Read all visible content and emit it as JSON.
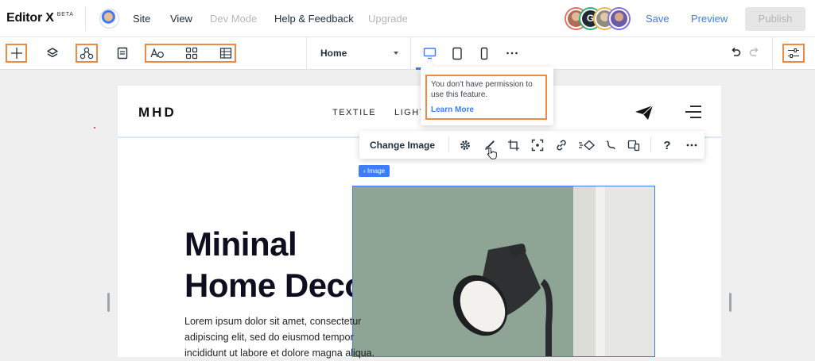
{
  "app": {
    "name": "Editor X",
    "badge": "BETA"
  },
  "topbar": {
    "menu": [
      {
        "label": "Site",
        "enabled": true
      },
      {
        "label": "View",
        "enabled": true
      },
      {
        "label": "Dev Mode",
        "enabled": false
      },
      {
        "label": "Help & Feedback",
        "enabled": true
      },
      {
        "label": "Upgrade",
        "enabled": false
      }
    ],
    "collaborator_initial": "G",
    "save_label": "Save",
    "preview_label": "Preview",
    "publish_label": "Publish"
  },
  "toolbar": {
    "page_selector_value": "Home",
    "active_breakpoint": "desktop",
    "icons": [
      "add-icon",
      "layers-icon",
      "site-structure-icon",
      "pages-icon",
      "typography-icon",
      "grid-icon",
      "table-icon",
      "desktop-icon",
      "tablet-icon",
      "mobile-icon",
      "more-icon",
      "undo-icon",
      "redo-icon",
      "settings-sliders-icon"
    ]
  },
  "tooltip": {
    "message": "You don't have permission to use this feature.",
    "link": "Learn More"
  },
  "site": {
    "brand": "MHD",
    "nav": [
      "TEXTILE",
      "LIGHT"
    ],
    "hero_title_line1": "Mininal",
    "hero_title_line2": "Home Decor",
    "hero_text_line1": "Lorem ipsum dolor sit amet, consectetur",
    "hero_text_line2": "adipiscing elit, sed do eiusmod tempor",
    "hero_text_line3": "incididunt ut labore et dolore magna aliqua."
  },
  "image_toolbar": {
    "change_image_label": "Change Image",
    "help_label": "?"
  },
  "selection": {
    "label": "Image"
  },
  "colors": {
    "accent": "#3e7cff",
    "highlight": "#ee8a44",
    "photo_wall": "#8ea495"
  }
}
